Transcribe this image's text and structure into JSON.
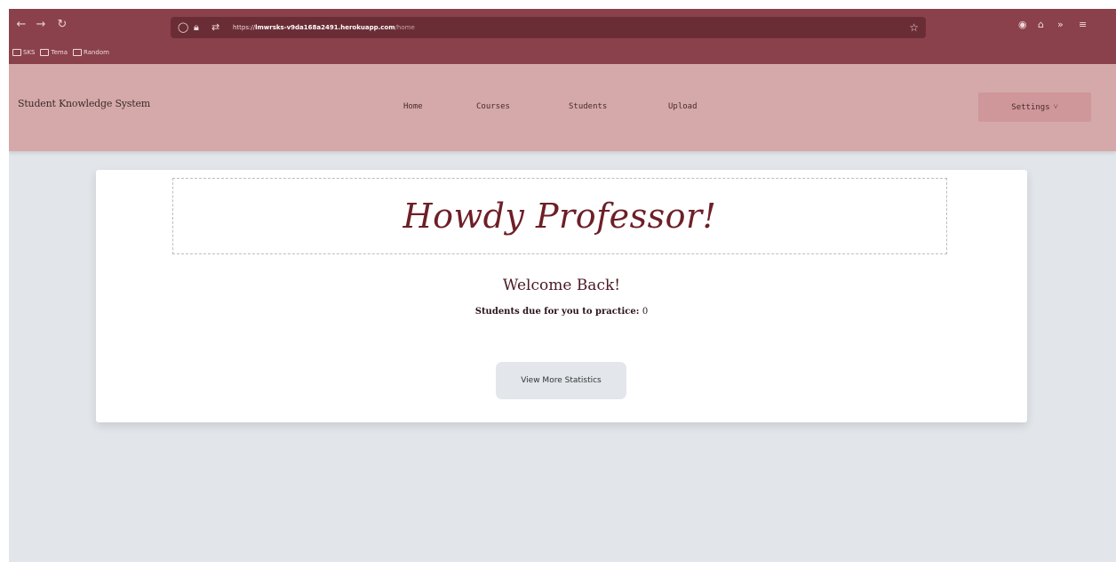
{
  "browser": {
    "url_scheme": "https://",
    "url_host": "lmwrsks-v9da168a2491.herokuapp.com",
    "url_path": "/home",
    "bookmarks": [
      {
        "label": "SKS"
      },
      {
        "label": "Tema"
      },
      {
        "label": "Random"
      }
    ]
  },
  "header": {
    "brand": "Student Knowledge System",
    "nav": [
      {
        "label": "Home"
      },
      {
        "label": "Courses"
      },
      {
        "label": "Students"
      },
      {
        "label": "Upload"
      }
    ],
    "settings_label": "Settings",
    "settings_caret": "˅"
  },
  "card": {
    "greeting": "Howdy Professor!",
    "welcome": "Welcome Back!",
    "due_label": "Students due for you to practice:",
    "due_count": "0",
    "stats_button": "View More Statistics"
  },
  "colors": {
    "chrome": "#8a414b",
    "header": "#d5a9a9",
    "accent_text": "#6d1f27",
    "page_bg": "#e2e6ea"
  }
}
